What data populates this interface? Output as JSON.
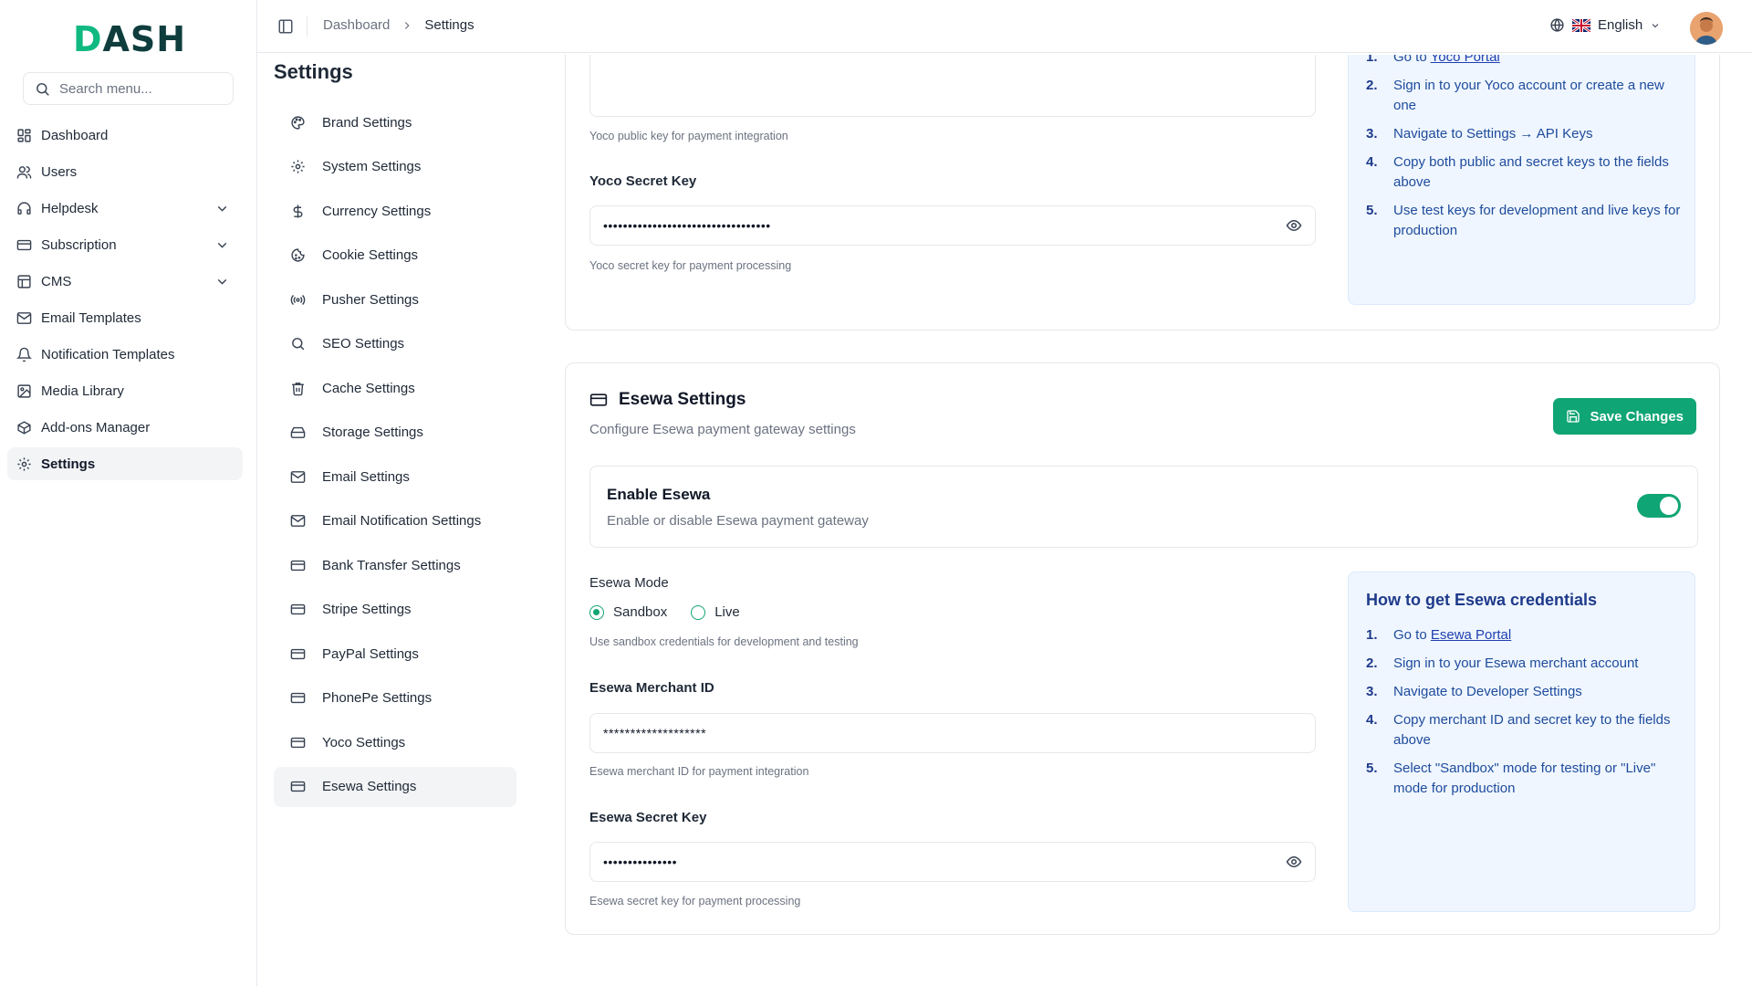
{
  "brand": {
    "logo_text_first": "D",
    "logo_text_rest": "ASH"
  },
  "sidebar": {
    "search_placeholder": "Search menu...",
    "items": [
      {
        "label": "Dashboard",
        "icon": "grid-icon"
      },
      {
        "label": "Users",
        "icon": "users-icon"
      },
      {
        "label": "Helpdesk",
        "icon": "headset-icon",
        "expandable": true
      },
      {
        "label": "Subscription",
        "icon": "card-icon",
        "expandable": true
      },
      {
        "label": "CMS",
        "icon": "layout-icon",
        "expandable": true
      },
      {
        "label": "Email Templates",
        "icon": "mail-icon"
      },
      {
        "label": "Notification Templates",
        "icon": "bell-icon"
      },
      {
        "label": "Media Library",
        "icon": "image-icon"
      },
      {
        "label": "Add-ons Manager",
        "icon": "package-icon"
      },
      {
        "label": "Settings",
        "icon": "gear-icon",
        "active": true
      }
    ]
  },
  "header": {
    "breadcrumb": [
      "Dashboard",
      "Settings"
    ],
    "language": "English"
  },
  "page": {
    "title": "Settings"
  },
  "settings_nav": {
    "items": [
      {
        "label": "Brand Settings",
        "icon": "palette-icon"
      },
      {
        "label": "System Settings",
        "icon": "gear-icon"
      },
      {
        "label": "Currency Settings",
        "icon": "dollar-icon"
      },
      {
        "label": "Cookie Settings",
        "icon": "cookie-icon"
      },
      {
        "label": "Pusher Settings",
        "icon": "broadcast-icon"
      },
      {
        "label": "SEO Settings",
        "icon": "search-icon"
      },
      {
        "label": "Cache Settings",
        "icon": "trash-icon"
      },
      {
        "label": "Storage Settings",
        "icon": "drive-icon"
      },
      {
        "label": "Email Settings",
        "icon": "mail-icon"
      },
      {
        "label": "Email Notification Settings",
        "icon": "mail-icon"
      },
      {
        "label": "Bank Transfer Settings",
        "icon": "card-icon"
      },
      {
        "label": "Stripe Settings",
        "icon": "card-icon"
      },
      {
        "label": "PayPal Settings",
        "icon": "card-icon"
      },
      {
        "label": "PhonePe Settings",
        "icon": "card-icon"
      },
      {
        "label": "Yoco Settings",
        "icon": "card-icon"
      },
      {
        "label": "Esewa Settings",
        "icon": "card-icon",
        "active": true
      }
    ]
  },
  "yoco": {
    "public_key_help": "Yoco public key for payment integration",
    "secret_key_label": "Yoco Secret Key",
    "secret_key_value": "••••••••••••••••••••••••••••••••••",
    "secret_key_help": "Yoco secret key for payment processing",
    "steps": [
      {
        "num": "1.",
        "text": "Go to ",
        "link": "Yoco Portal"
      },
      {
        "num": "2.",
        "text": "Sign in to your Yoco account or create a new one"
      },
      {
        "num": "3.",
        "text": "Navigate to Settings → API Keys"
      },
      {
        "num": "4.",
        "text": "Copy both public and secret keys to the fields above"
      },
      {
        "num": "5.",
        "text": "Use test keys for development and live keys for production"
      }
    ]
  },
  "esewa": {
    "title": "Esewa Settings",
    "subtitle": "Configure Esewa payment gateway settings",
    "save_label": "Save Changes",
    "enable_title": "Enable Esewa",
    "enable_sub": "Enable or disable Esewa payment gateway",
    "enabled": true,
    "mode_label": "Esewa Mode",
    "mode_options": [
      "Sandbox",
      "Live"
    ],
    "mode_selected": "Sandbox",
    "mode_help": "Use sandbox credentials for development and testing",
    "merchant_label": "Esewa Merchant ID",
    "merchant_value": "*******************",
    "merchant_help": "Esewa merchant ID for payment integration",
    "secret_label": "Esewa Secret Key",
    "secret_value": "•••••••••••••••",
    "secret_help": "Esewa secret key for payment processing",
    "info_title": "How to get Esewa credentials",
    "steps": [
      {
        "num": "1.",
        "text": "Go to ",
        "link": "Esewa Portal"
      },
      {
        "num": "2.",
        "text": "Sign in to your Esewa merchant account"
      },
      {
        "num": "3.",
        "text": "Navigate to Developer Settings"
      },
      {
        "num": "4.",
        "text": "Copy merchant ID and secret key to the fields above"
      },
      {
        "num": "5.",
        "text": "Select \"Sandbox\" mode for testing or \"Live\" mode for production"
      }
    ]
  },
  "colors": {
    "accent": "#10a574",
    "info_bg": "#eff6ff",
    "info_text": "#1e4b9c"
  }
}
